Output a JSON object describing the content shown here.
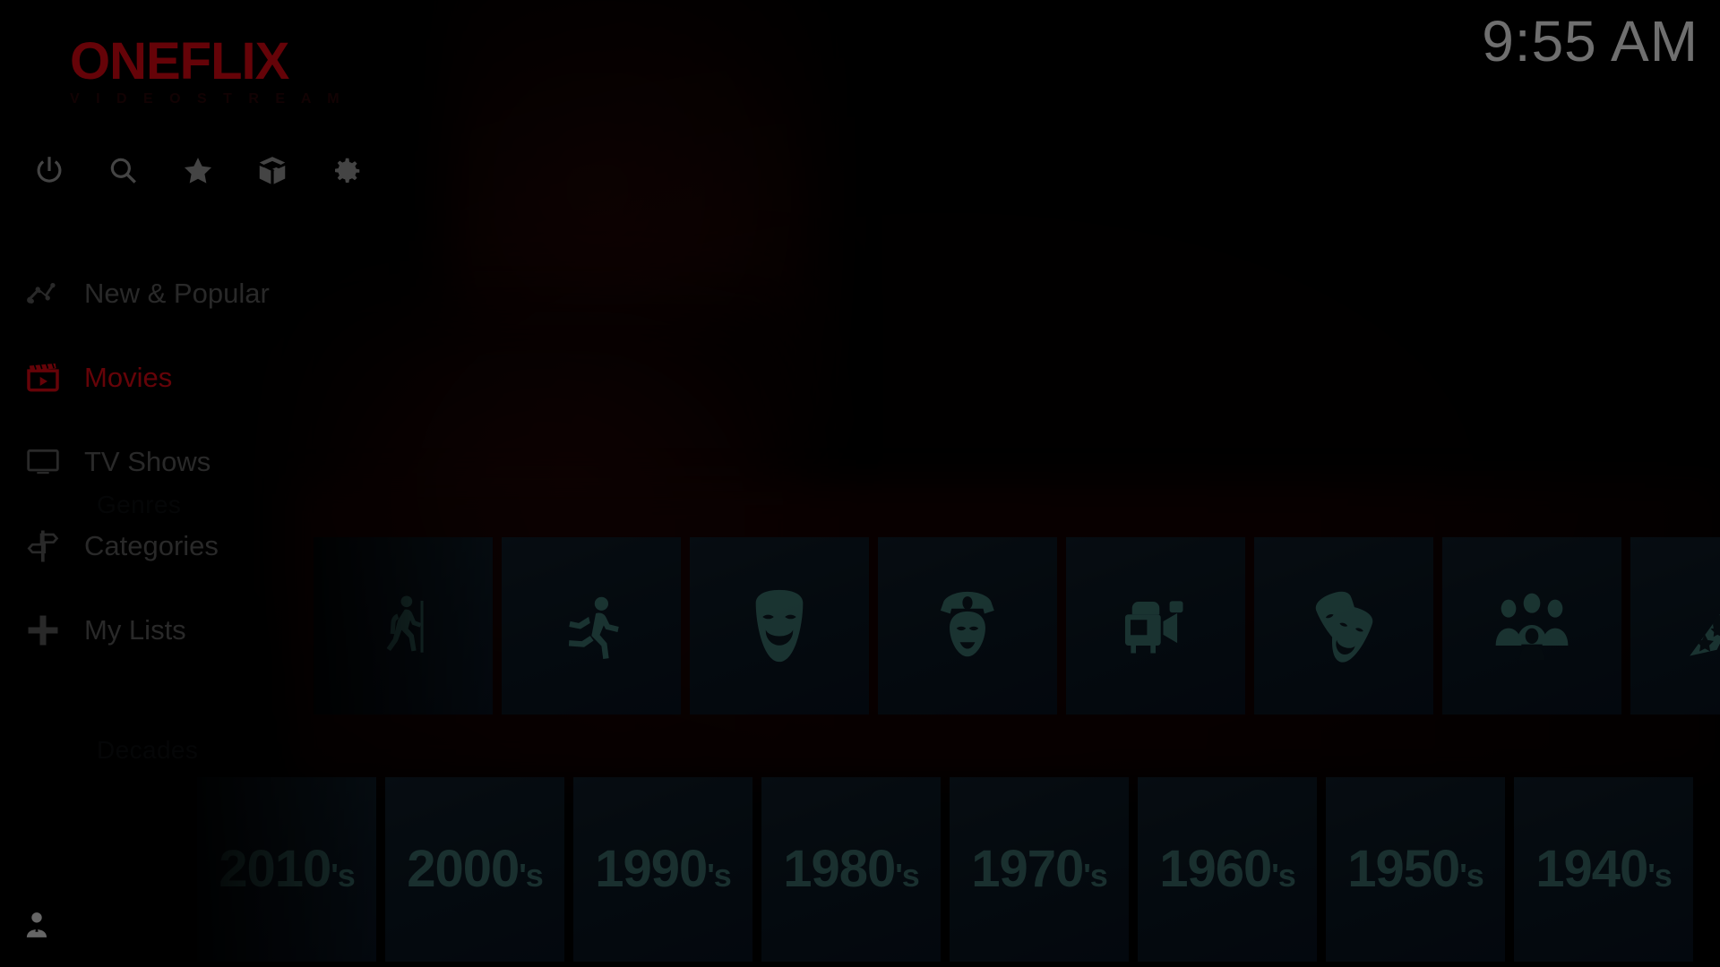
{
  "app": {
    "logo": "ONEFLIX",
    "logo_subtitle": "V I D E O   S T R E A M",
    "accent_color": "#e50914",
    "tile_bg_color": "#0d1a24",
    "tile_icon_color": "#3f7b76",
    "background_color": "#000000"
  },
  "clock": {
    "time": "9:55 AM"
  },
  "toolbar": {
    "items": [
      {
        "name": "power-icon",
        "label": "Power"
      },
      {
        "name": "search-icon",
        "label": "Search"
      },
      {
        "name": "favorites-icon",
        "label": "Favourites"
      },
      {
        "name": "addons-icon",
        "label": "Add-ons"
      },
      {
        "name": "settings-icon",
        "label": "Settings"
      }
    ]
  },
  "sidebar": {
    "items": [
      {
        "label": "New & Popular",
        "icon": "trending-icon",
        "active": false
      },
      {
        "label": "Movies",
        "icon": "clapperboard-icon",
        "active": true
      },
      {
        "label": "TV Shows",
        "icon": "tv-icon",
        "active": false
      },
      {
        "label": "Categories",
        "icon": "signpost-icon",
        "active": false
      },
      {
        "label": "My Lists",
        "icon": "plus-icon",
        "active": false
      }
    ],
    "profile": {
      "icon": "user-avatar-icon",
      "label": "Profile"
    }
  },
  "content": {
    "rows": [
      {
        "title": "Genres",
        "type": "icon-tiles",
        "tiles": [
          {
            "label": "Adventure",
            "icon": "hiker-icon"
          },
          {
            "label": "Action",
            "icon": "runner-icon"
          },
          {
            "label": "Comedy",
            "icon": "comedy-mask-icon"
          },
          {
            "label": "Crime",
            "icon": "police-officer-icon"
          },
          {
            "label": "Documentary",
            "icon": "video-camera-icon"
          },
          {
            "label": "Drama",
            "icon": "theatre-masks-icon"
          },
          {
            "label": "Family",
            "icon": "people-group-icon"
          },
          {
            "label": "Fantasy",
            "icon": "wizard-hat-icon"
          }
        ]
      },
      {
        "title": "Decades",
        "type": "text-tiles",
        "tiles": [
          {
            "decade": "2010",
            "suffix": "'s"
          },
          {
            "decade": "2000",
            "suffix": "'s"
          },
          {
            "decade": "1990",
            "suffix": "'s"
          },
          {
            "decade": "1980",
            "suffix": "'s"
          },
          {
            "decade": "1970",
            "suffix": "'s"
          },
          {
            "decade": "1960",
            "suffix": "'s"
          },
          {
            "decade": "1950",
            "suffix": "'s"
          },
          {
            "decade": "1940",
            "suffix": "'s"
          }
        ]
      }
    ]
  }
}
